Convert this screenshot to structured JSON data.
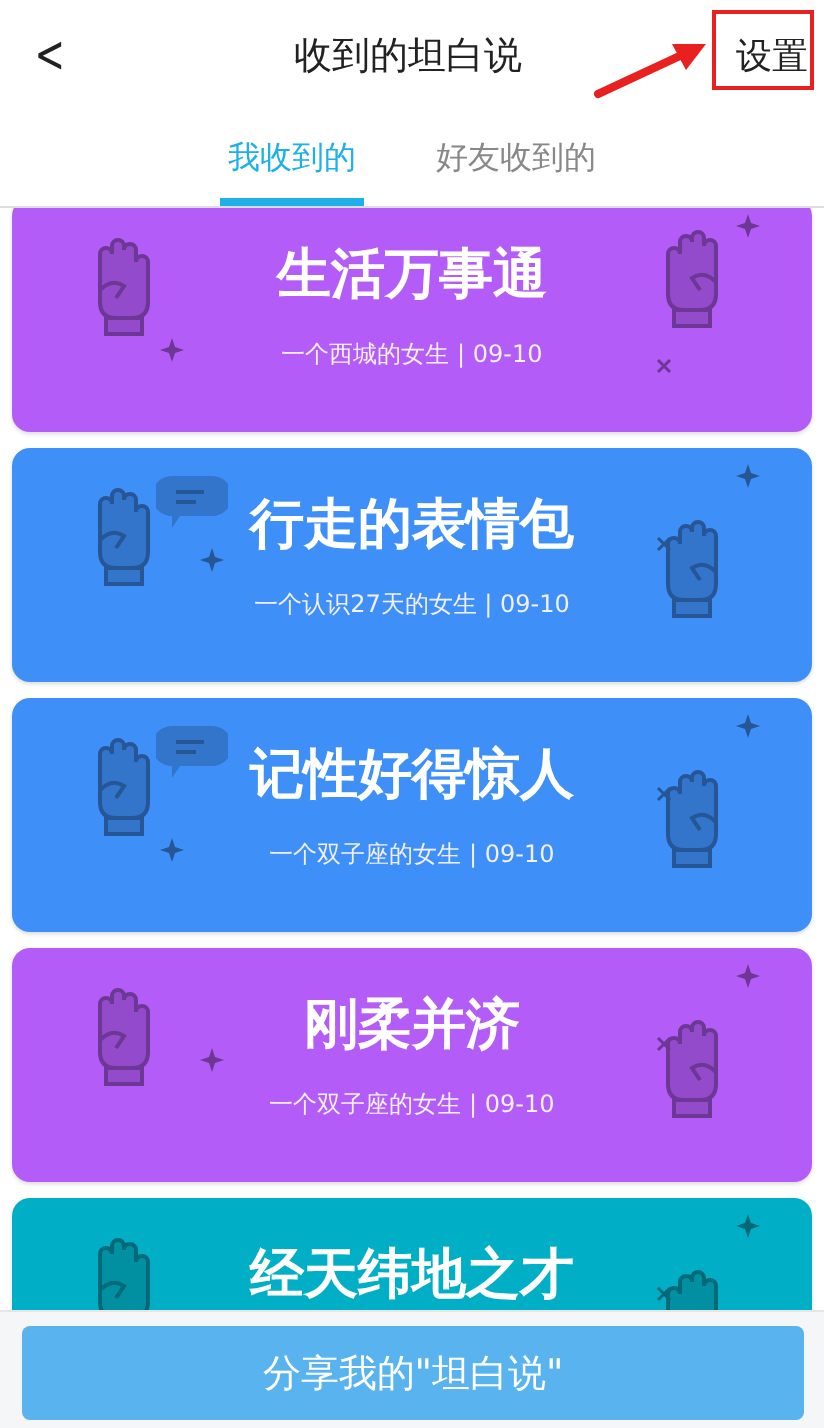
{
  "header": {
    "back": "<",
    "title": "收到的坦白说",
    "action": "设置"
  },
  "tabs": [
    {
      "label": "我收到的",
      "selected": true
    },
    {
      "label": "好友收到的",
      "selected": false
    }
  ],
  "cards": [
    {
      "title": "生活万事通",
      "subtitle": "一个西城的女生 | 09-10",
      "color": "#b45cf8",
      "bubble": false
    },
    {
      "title": "行走的表情包",
      "subtitle": "一个认识27天的女生 | 09-10",
      "color": "#3f8ff9",
      "bubble": true
    },
    {
      "title": "记性好得惊人",
      "subtitle": "一个双子座的女生 | 09-10",
      "color": "#3f8ff9",
      "bubble": true
    },
    {
      "title": "刚柔并济",
      "subtitle": "一个双子座的女生 | 09-10",
      "color": "#b45cf8",
      "bubble": false
    },
    {
      "title": "经天纬地之才",
      "color": "#00afc6",
      "bubble": false
    }
  ],
  "share_button": "分享我的\"坦白说\""
}
